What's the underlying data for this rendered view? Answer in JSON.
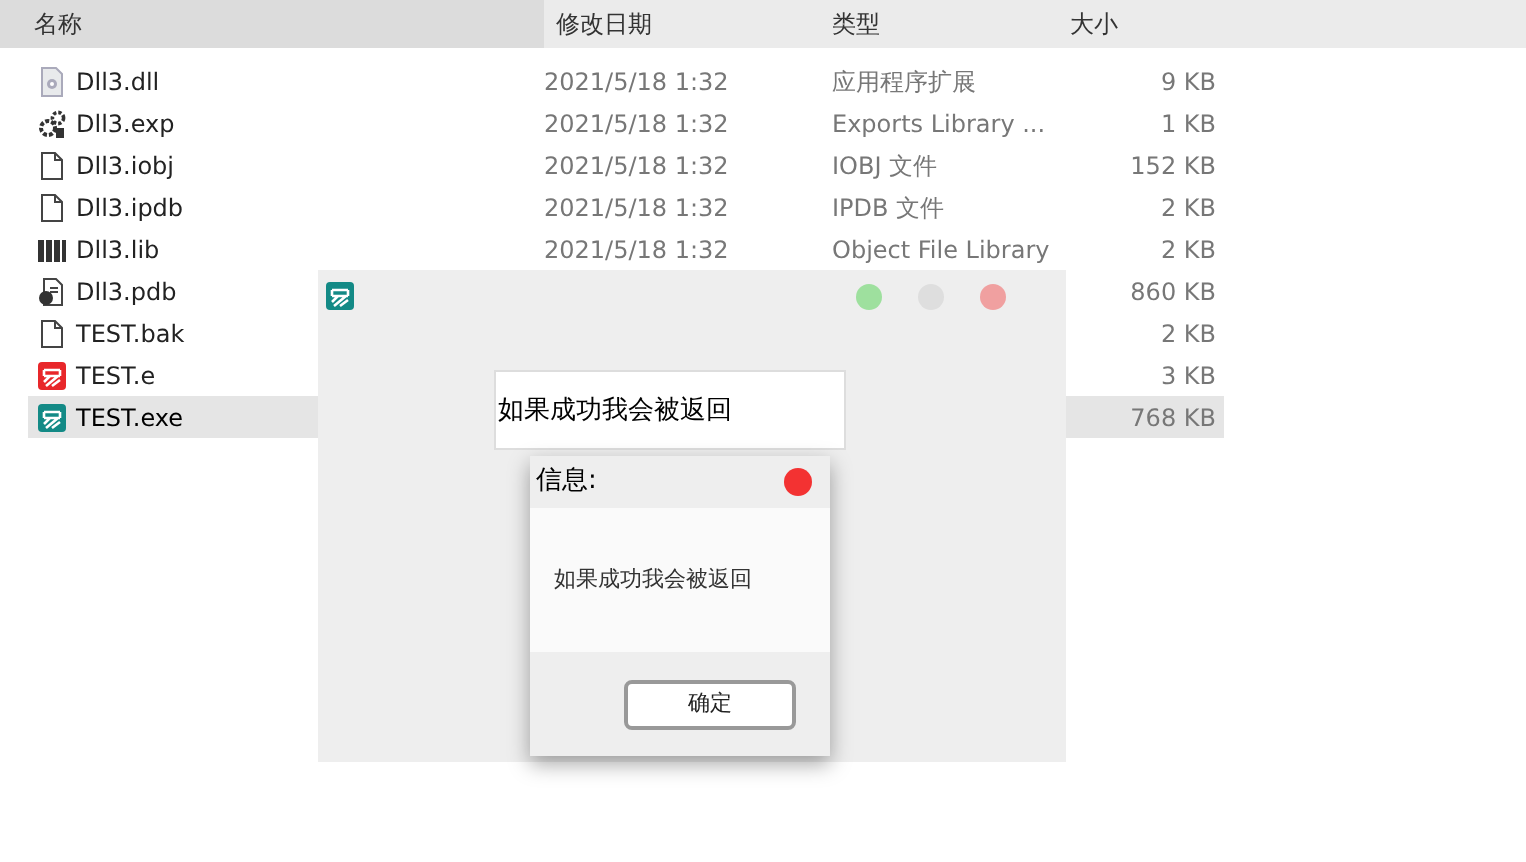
{
  "columns": [
    {
      "label": "名称"
    },
    {
      "label": "修改日期"
    },
    {
      "label": "类型"
    },
    {
      "label": "大小"
    }
  ],
  "files": [
    {
      "kind": "dll",
      "name": "Dll3.dll",
      "date": "2021/5/18 1:32",
      "type": "应用程序扩展",
      "size": "9 KB",
      "selected": false
    },
    {
      "kind": "exp",
      "name": "Dll3.exp",
      "date": "2021/5/18 1:32",
      "type": "Exports Library ...",
      "size": "1 KB",
      "selected": false
    },
    {
      "kind": "doc",
      "name": "Dll3.iobj",
      "date": "2021/5/18 1:32",
      "type": "IOBJ 文件",
      "size": "152 KB",
      "selected": false
    },
    {
      "kind": "doc",
      "name": "Dll3.ipdb",
      "date": "2021/5/18 1:32",
      "type": "IPDB 文件",
      "size": "2 KB",
      "selected": false
    },
    {
      "kind": "lib",
      "name": "Dll3.lib",
      "date": "2021/5/18 1:32",
      "type": "Object File Library",
      "size": "2 KB",
      "selected": false
    },
    {
      "kind": "pdb",
      "name": "Dll3.pdb",
      "size": "860 KB",
      "selected": false
    },
    {
      "kind": "doc",
      "name": "TEST.bak",
      "size": "2 KB",
      "selected": false
    },
    {
      "kind": "e",
      "name": "TEST.e",
      "size": "3 KB",
      "selected": false
    },
    {
      "kind": "exe",
      "name": "TEST.exe",
      "size": "768 KB",
      "selected": true
    }
  ],
  "app_window": {
    "field_value": "如果成功我会被返回",
    "message_box": {
      "title": "信息:",
      "message": "如果成功我会被返回",
      "button": "确定"
    }
  }
}
